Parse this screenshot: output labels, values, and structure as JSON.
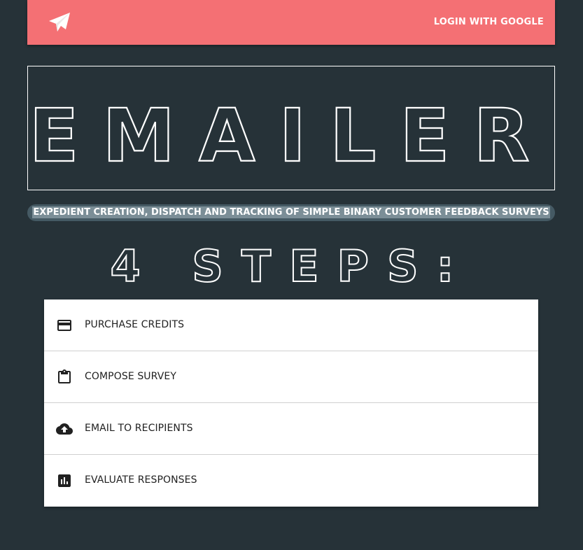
{
  "navbar": {
    "logo_icon": "paper-plane-icon",
    "login_label": "LOGIN WITH GOOGLE",
    "color": "#f47074"
  },
  "hero": {
    "title": "EMAILER"
  },
  "tagline": "EXPEDIENT CREATION, DISPATCH AND TRACKING OF SIMPLE BINARY CUSTOMER FEEDBACK SURVEYS",
  "steps_heading": "4 STEPS:",
  "steps": [
    {
      "icon": "credit-card-icon",
      "label": "PURCHASE CREDITS"
    },
    {
      "icon": "clipboard-icon",
      "label": "COMPOSE SURVEY"
    },
    {
      "icon": "cloud-upload-icon",
      "label": "EMAIL TO RECIPIENTS"
    },
    {
      "icon": "bar-chart-icon",
      "label": "EVALUATE RESPONSES"
    }
  ],
  "colors": {
    "background": "#263238",
    "accent": "#f47074",
    "tagline_bar": "#455a64"
  }
}
